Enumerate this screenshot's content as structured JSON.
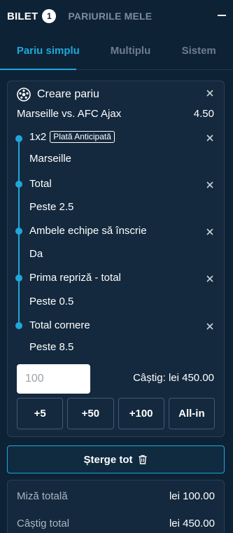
{
  "header": {
    "bilet_label": "BILET",
    "bilet_count": "1",
    "mele_label": "PARIURILE MELE",
    "minimize_icon": "minus-icon"
  },
  "tabs": [
    {
      "label": "Pariu simplu",
      "active": true
    },
    {
      "label": "Multiplu",
      "active": false
    },
    {
      "label": "Sistem",
      "active": false
    }
  ],
  "bet": {
    "create_label": "Creare pariu",
    "create_icon": "soccer-ball-icon",
    "match": "Marseille vs. AFC Ajax",
    "odds": "4.50",
    "selections": [
      {
        "market": "1x2",
        "tag": "Plată Anticipată",
        "pick": "Marseille"
      },
      {
        "market": "Total",
        "tag": "",
        "pick": "Peste 2.5"
      },
      {
        "market": "Ambele echipe să înscrie",
        "tag": "",
        "pick": "Da"
      },
      {
        "market": "Prima repriză - total",
        "tag": "",
        "pick": "Peste 0.5"
      },
      {
        "market": "Total cornere",
        "tag": "",
        "pick": "Peste 8.5"
      }
    ],
    "stake_placeholder": "100",
    "win_label": "Câștig: lei 450.00",
    "quick_stakes": [
      "+5",
      "+50",
      "+100",
      "All-in"
    ]
  },
  "clear_all_label": "Șterge tot",
  "clear_all_icon": "trash-icon",
  "summary": {
    "total_stake_label": "Miză totală",
    "total_stake_value": "lei 100.00",
    "total_win_label": "Câștig total",
    "total_win_value": "lei 450.00"
  },
  "colors": {
    "background": "#0e2236",
    "card": "#14293e",
    "accent": "#1fa7d9",
    "muted_text": "#7d8c9c"
  }
}
